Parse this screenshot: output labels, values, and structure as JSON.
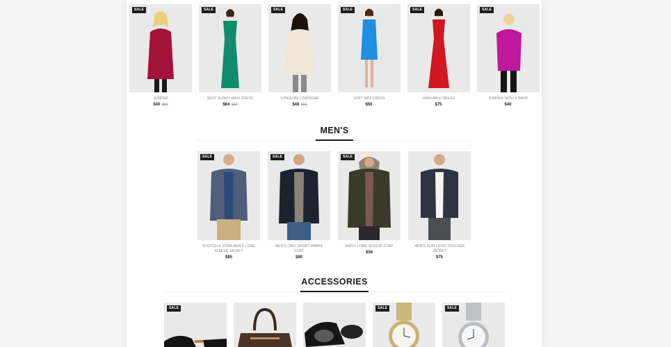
{
  "women": {
    "products": [
      {
        "name": "Jumper",
        "price": "$40",
        "old_price": "$80",
        "sale": "SALE"
      },
      {
        "name": "Sexy Slinky Maxi Dress",
        "price": "$64",
        "old_price": "$80",
        "sale": "SALE"
      },
      {
        "name": "Longline Cardigan",
        "price": "$48",
        "old_price": "$80",
        "sale": "SALE"
      },
      {
        "name": "Soft Midi Dress",
        "price": "$50",
        "old_price": "",
        "sale": "SALE"
      },
      {
        "name": "High Maxi Dress",
        "price": "$75",
        "old_price": "",
        "sale": "SALE"
      },
      {
        "name": "Jumper With V Back",
        "price": "$40",
        "old_price": "",
        "sale": "SALE"
      }
    ]
  },
  "mens": {
    "title": "MEN'S",
    "products": [
      {
        "name": "Scotch & Soda Men's Long Sleeve Jacket",
        "price": "$85",
        "sale": "SALE"
      },
      {
        "name": "Men's Call Short Parka Coat",
        "price": "$80",
        "sale": "SALE"
      },
      {
        "name": "Men's Long Sleeve Coat",
        "price": "$56",
        "sale": "SALE"
      },
      {
        "name": "Men's Slim Levis Trucker Jacket",
        "price": "$75",
        "sale": ""
      }
    ]
  },
  "accessories": {
    "title": "ACCESSORIES",
    "products": [
      {
        "sale": "SALE"
      },
      {
        "sale": ""
      },
      {
        "sale": ""
      },
      {
        "sale": "SALE"
      },
      {
        "sale": "SALE"
      }
    ]
  },
  "colors": {
    "page_bg": "#f4f4f4",
    "card_bg": "#e9e9e9",
    "badge_bg": "#1c1c1c",
    "garments": [
      "#a3123a",
      "#0f8c6c",
      "#efe6d6",
      "#1f8fe0",
      "#d01722",
      "#c0189a"
    ],
    "jackets": [
      "#4f5f7a",
      "#1d2230",
      "#3b3a2a",
      "#2f3440"
    ]
  }
}
